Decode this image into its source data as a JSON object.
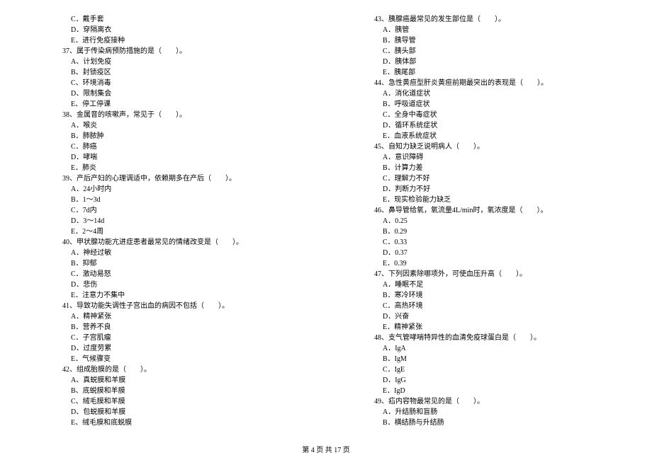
{
  "left": [
    {
      "cls": "indent-1",
      "t": "C．戴手套"
    },
    {
      "cls": "indent-1",
      "t": "D．穿隔离衣"
    },
    {
      "cls": "indent-1",
      "t": "E．进行免疫接种"
    },
    {
      "cls": "q",
      "t": "37、属于传染病预防措施的是（　　）。"
    },
    {
      "cls": "indent-1",
      "t": "A、计划免疫"
    },
    {
      "cls": "indent-1",
      "t": "B、封锁疫区"
    },
    {
      "cls": "indent-1",
      "t": "C、环境消毒"
    },
    {
      "cls": "indent-1",
      "t": "D、限制集会"
    },
    {
      "cls": "indent-1",
      "t": "E、停工停课"
    },
    {
      "cls": "q",
      "t": "38、金属音的咳嗽声，常见于（　　）。"
    },
    {
      "cls": "indent-1",
      "t": "A．喉炎"
    },
    {
      "cls": "indent-1",
      "t": "B．肺脓肿"
    },
    {
      "cls": "indent-1",
      "t": "C．肺癌"
    },
    {
      "cls": "indent-1",
      "t": "D．哮喘"
    },
    {
      "cls": "indent-1",
      "t": "E．肺炎"
    },
    {
      "cls": "q",
      "t": "39、产后产妇的心理调适中，依赖期多在产后（　　）。"
    },
    {
      "cls": "indent-1",
      "t": "A．24小时内"
    },
    {
      "cls": "indent-1",
      "t": "B．1～3d"
    },
    {
      "cls": "indent-1",
      "t": "C．7d内"
    },
    {
      "cls": "indent-1",
      "t": "D．3～14d"
    },
    {
      "cls": "indent-1",
      "t": "E．2～4周"
    },
    {
      "cls": "q",
      "t": "40、甲状腺功能亢进症患者最常见的情绪改变是（　　）。"
    },
    {
      "cls": "indent-1",
      "t": "A．神经过敏"
    },
    {
      "cls": "indent-1",
      "t": "B．抑郁"
    },
    {
      "cls": "indent-1",
      "t": "C．激动易怒"
    },
    {
      "cls": "indent-1",
      "t": "D．悲伤"
    },
    {
      "cls": "indent-1",
      "t": "E．注意力不集中"
    },
    {
      "cls": "q",
      "t": "41、导致功能失调性子宫出血的病因不包括（　　）。"
    },
    {
      "cls": "indent-1",
      "t": "A．精神紧张"
    },
    {
      "cls": "indent-1",
      "t": "B．营养不良"
    },
    {
      "cls": "indent-1",
      "t": "C．子宫肌瘤"
    },
    {
      "cls": "indent-1",
      "t": "D．过度劳累"
    },
    {
      "cls": "indent-1",
      "t": "E．气候骤变"
    },
    {
      "cls": "q",
      "t": "42、组成胎膜的是（　　）。"
    },
    {
      "cls": "indent-1",
      "t": "A、真蜕膜和羊膜"
    },
    {
      "cls": "indent-1",
      "t": "B、底蜕膜和羊膜"
    },
    {
      "cls": "indent-1",
      "t": "C、绒毛膜和羊膜"
    },
    {
      "cls": "indent-1",
      "t": "D、包蜕膜和羊膜"
    },
    {
      "cls": "indent-1",
      "t": "E、绒毛膜和底蜕膜"
    }
  ],
  "right": [
    {
      "cls": "q",
      "t": "43、胰腺癌最常见的发生部位是（　　）。"
    },
    {
      "cls": "indent-1",
      "t": "A．胰管"
    },
    {
      "cls": "indent-1",
      "t": "B．胰导管"
    },
    {
      "cls": "indent-1",
      "t": "C．胰头部"
    },
    {
      "cls": "indent-1",
      "t": "D．胰体部"
    },
    {
      "cls": "indent-1",
      "t": "E．胰尾部"
    },
    {
      "cls": "q",
      "t": "44、急性黄疸型肝炎黄疸前期最突出的表现是（　　）。"
    },
    {
      "cls": "indent-1",
      "t": "A．消化道症状"
    },
    {
      "cls": "indent-1",
      "t": "B．呼吸道症状"
    },
    {
      "cls": "indent-1",
      "t": "C．全身中毒症状"
    },
    {
      "cls": "indent-1",
      "t": "D．循环系统症状"
    },
    {
      "cls": "indent-1",
      "t": "E．血液系统症状"
    },
    {
      "cls": "q",
      "t": "45、自知力缺乏说明病人（　　）。"
    },
    {
      "cls": "indent-1",
      "t": "A．意识障碍"
    },
    {
      "cls": "indent-1",
      "t": "B．计算力差"
    },
    {
      "cls": "indent-1",
      "t": "C．理解力不好"
    },
    {
      "cls": "indent-1",
      "t": "D．判断力不好"
    },
    {
      "cls": "indent-1",
      "t": "E．现实检验能力缺乏"
    },
    {
      "cls": "q",
      "t": "46、鼻导管给氧，氧流量4L/min时，氧浓度是（　　）。"
    },
    {
      "cls": "indent-1",
      "t": "A．0.25"
    },
    {
      "cls": "indent-1",
      "t": "B．0.29"
    },
    {
      "cls": "indent-1",
      "t": "C．0.33"
    },
    {
      "cls": "indent-1",
      "t": "D．0.37"
    },
    {
      "cls": "indent-1",
      "t": "E．0.39"
    },
    {
      "cls": "q",
      "t": "47、下列因素除哪项外，可使血压升高（　　）。"
    },
    {
      "cls": "indent-1",
      "t": "A．睡眠不足"
    },
    {
      "cls": "indent-1",
      "t": "B．寒冷环境"
    },
    {
      "cls": "indent-1",
      "t": "C．高热环境"
    },
    {
      "cls": "indent-1",
      "t": "D．兴奋"
    },
    {
      "cls": "indent-1",
      "t": "E．精神紧张"
    },
    {
      "cls": "q",
      "t": "48、支气管哮喘特异性的血清免疫球蛋白是（　　）。"
    },
    {
      "cls": "indent-1",
      "t": "A．IgA"
    },
    {
      "cls": "indent-1",
      "t": "B．IgM"
    },
    {
      "cls": "indent-1",
      "t": "C．IgE"
    },
    {
      "cls": "indent-1",
      "t": "D．IgG"
    },
    {
      "cls": "indent-1",
      "t": "E．IgD"
    },
    {
      "cls": "q",
      "t": "49、疝内容物最常见的是（　　）。"
    },
    {
      "cls": "indent-1",
      "t": "A．升结肠和盲肠"
    },
    {
      "cls": "indent-1",
      "t": "B．横结肠与升结肠"
    }
  ],
  "footer": "第 4 页 共 17 页"
}
